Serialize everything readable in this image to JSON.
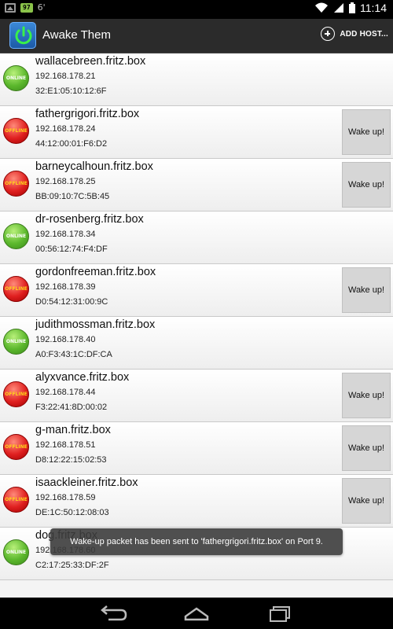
{
  "statusbar": {
    "battery_small": "97",
    "six": "6'",
    "time": "11:14"
  },
  "app": {
    "title": "Awake Them",
    "add_host_label": "ADD HOST..."
  },
  "status_labels": {
    "online": "ONLINE",
    "offline": "OFFLINE"
  },
  "hosts": [
    {
      "name": "wallacebreen.fritz.box",
      "ip": "192.168.178.21",
      "mac": "32:E1:05:10:12:6F",
      "status": "online",
      "wake": ""
    },
    {
      "name": "fathergrigori.fritz.box",
      "ip": "192.168.178.24",
      "mac": "44:12:00:01:F6:D2",
      "status": "offline",
      "wake": "Wake up!"
    },
    {
      "name": "barneycalhoun.fritz.box",
      "ip": "192.168.178.25",
      "mac": "BB:09:10:7C:5B:45",
      "status": "offline",
      "wake": "Wake up!"
    },
    {
      "name": "dr-rosenberg.fritz.box",
      "ip": "192.168.178.34",
      "mac": "00:56:12:74:F4:DF",
      "status": "online",
      "wake": ""
    },
    {
      "name": "gordonfreeman.fritz.box",
      "ip": "192.168.178.39",
      "mac": "D0:54:12:31:00:9C",
      "status": "offline",
      "wake": "Wake up!"
    },
    {
      "name": "judithmossman.fritz.box",
      "ip": "192.168.178.40",
      "mac": "A0:F3:43:1C:DF:CA",
      "status": "online",
      "wake": ""
    },
    {
      "name": "alyxvance.fritz.box",
      "ip": "192.168.178.44",
      "mac": "F3:22:41:8D:00:02",
      "status": "offline",
      "wake": "Wake up!"
    },
    {
      "name": "g-man.fritz.box",
      "ip": "192.168.178.51",
      "mac": "D8:12:22:15:02:53",
      "status": "offline",
      "wake": "Wake up!"
    },
    {
      "name": "isaackleiner.fritz.box",
      "ip": "192.168.178.59",
      "mac": "DE:1C:50:12:08:03",
      "status": "offline",
      "wake": "Wake up!"
    },
    {
      "name": "dog.fritz.box",
      "ip": "192.168.178.60",
      "mac": "C2:17:25:33:DF:2F",
      "status": "online",
      "wake": ""
    }
  ],
  "toast": "Wake-up packet has been sent to 'fathergrigori.fritz.box' on Port 9."
}
